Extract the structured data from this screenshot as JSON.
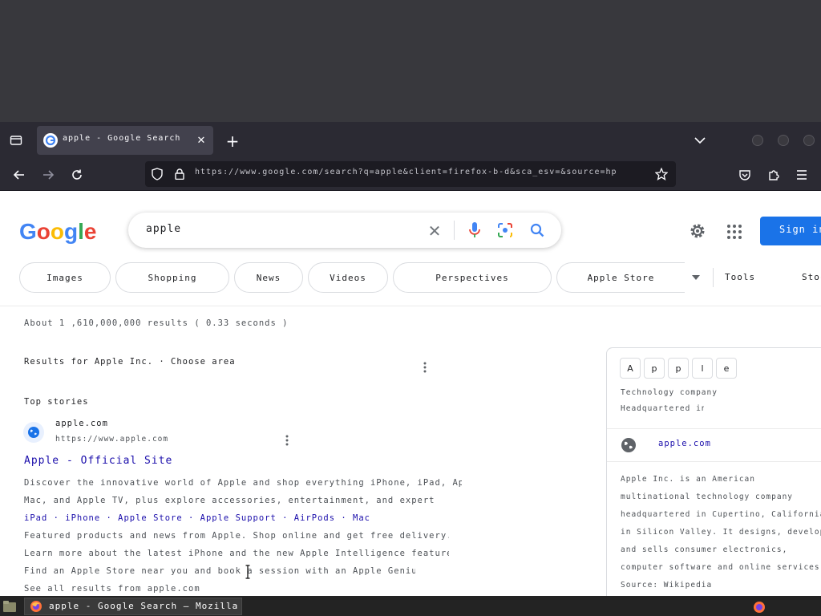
{
  "browser": {
    "tab_title": "apple - Google Search",
    "new_tab_symbol": "+",
    "url": "https://www.google.com/search?q=apple&client=firefox-b-d&sca_esv=&source=hp"
  },
  "google": {
    "logo": "Google",
    "search_query": "apple",
    "sign_in_label": "Sign in",
    "chips": [
      "Images",
      "Shopping",
      "News",
      "Videos",
      "Perspectives",
      "Apple Store",
      "More",
      "Tools",
      "Stock"
    ],
    "stats_line": "About 1 ,610,000,000 results ( 0.33 seconds )",
    "news_heading_line": "Results for Apple Inc. · Choose area",
    "section_heading": "Top stories",
    "result": {
      "site_name": "apple.com",
      "site_url": "https://www.apple.com",
      "title": "Apple - Official Site",
      "snippet_lines": [
        "Discover the innovative world of Apple and shop everything iPhone, iPad, Apple Watch,",
        "Mac, and Apple TV, plus explore accessories, entertainment, and expert device support.",
        "iPad · iPhone · Apple Store · Apple Support · AirPods · Mac",
        "Featured products and news from Apple. Shop online and get free delivery.",
        "Learn more about the latest iPhone and the new Apple Intelligence features and updates.",
        "Find an Apple Store near you and book a session with an Apple Genius today.",
        "See all results from apple.com"
      ]
    },
    "knowledge_panel": {
      "letters": [
        "A",
        "p",
        "p",
        "l",
        "e"
      ],
      "subtitle_1": "Technology company",
      "subtitle_2": "Headquartered in",
      "website": "apple.com",
      "description_lines": [
        "Apple Inc. is an American",
        "multinational technology company",
        "headquartered in Cupertino, California,",
        "in Silicon Valley. It designs, develops,",
        "and sells consumer electronics,",
        "computer software and online services.",
        "Source: Wikipedia"
      ]
    }
  },
  "taskbar": {
    "window_title": "apple - Google Search — Mozilla Firefox"
  },
  "colors": {
    "google_blue": "#4285f4",
    "google_red": "#ea4335",
    "google_yellow": "#fbbc05",
    "google_green": "#34a853",
    "sign_in_blue": "#1a73e8",
    "link_blue": "#1a0dab"
  }
}
